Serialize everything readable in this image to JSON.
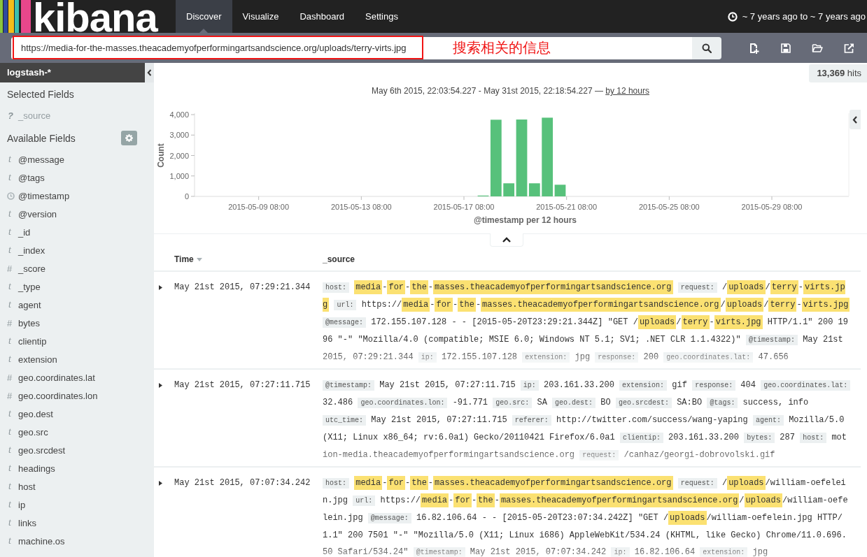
{
  "nav": {
    "logo": "kibana",
    "tabs": [
      {
        "label": "Discover",
        "selected": true
      },
      {
        "label": "Visualize",
        "selected": false
      },
      {
        "label": "Dashboard",
        "selected": false
      },
      {
        "label": "Settings",
        "selected": false
      }
    ],
    "time_range": "~ 7 years ago to ~ 7 years ago"
  },
  "query": {
    "value": "https://media-for-the-masses.theacademyofperformingartsandscience.org/uploads/terry-virts.jpg",
    "annotation": "搜索相关的信息"
  },
  "sidebar": {
    "index_pattern": "logstash-*",
    "selected_title": "Selected Fields",
    "selected_fields": [
      {
        "name": "_source",
        "kind": "unknown",
        "icon": "?"
      }
    ],
    "available_title": "Available Fields",
    "available_fields": [
      {
        "name": "@message",
        "kind": "string",
        "icon": "t"
      },
      {
        "name": "@tags",
        "kind": "string",
        "icon": "t"
      },
      {
        "name": "@timestamp",
        "kind": "date"
      },
      {
        "name": "@version",
        "kind": "string",
        "icon": "t"
      },
      {
        "name": "_id",
        "kind": "string",
        "icon": "t"
      },
      {
        "name": "_index",
        "kind": "string",
        "icon": "t"
      },
      {
        "name": "_score",
        "kind": "number",
        "icon": "#"
      },
      {
        "name": "_type",
        "kind": "string",
        "icon": "t"
      },
      {
        "name": "agent",
        "kind": "string",
        "icon": "t"
      },
      {
        "name": "bytes",
        "kind": "number",
        "icon": "#"
      },
      {
        "name": "clientip",
        "kind": "string",
        "icon": "t"
      },
      {
        "name": "extension",
        "kind": "string",
        "icon": "t"
      },
      {
        "name": "geo.coordinates.lat",
        "kind": "number",
        "icon": "#"
      },
      {
        "name": "geo.coordinates.lon",
        "kind": "number",
        "icon": "#"
      },
      {
        "name": "geo.dest",
        "kind": "string",
        "icon": "t"
      },
      {
        "name": "geo.src",
        "kind": "string",
        "icon": "t"
      },
      {
        "name": "geo.srcdest",
        "kind": "string",
        "icon": "t"
      },
      {
        "name": "headings",
        "kind": "string",
        "icon": "t"
      },
      {
        "name": "host",
        "kind": "string",
        "icon": "t"
      },
      {
        "name": "ip",
        "kind": "string",
        "icon": "t"
      },
      {
        "name": "links",
        "kind": "string",
        "icon": "t"
      },
      {
        "name": "machine.os",
        "kind": "string",
        "icon": "t"
      }
    ]
  },
  "hits": "**13,369** hits",
  "time_header": {
    "range": "May 6th 2015, 22:03:54.227 - May 31st 2015, 22:18:54.227 — ",
    "interval_link": "by 12 hours"
  },
  "histogram": {
    "chart_data": {
      "type": "bar",
      "xlabel": "@timestamp per 12 hours",
      "ylabel": "Count",
      "categories": [
        null,
        null,
        null,
        null,
        null,
        "2015-05-09 08:00",
        null,
        null,
        null,
        null,
        null,
        null,
        null,
        "2015-05-13 08:00",
        null,
        null,
        null,
        null,
        null,
        null,
        null,
        "2015-05-17 08:00",
        null,
        null,
        null,
        null,
        null,
        null,
        null,
        "2015-05-21 08:00",
        null,
        null,
        null,
        null,
        null,
        null,
        null,
        "2015-05-25 08:00",
        null,
        null,
        null,
        null,
        null,
        null,
        null,
        "2015-05-29 08:00",
        null,
        null,
        null,
        null,
        null
      ],
      "series": [
        {
          "color": "#57c17b",
          "values": [
            null,
            null,
            null,
            null,
            null,
            null,
            null,
            null,
            null,
            null,
            null,
            null,
            null,
            null,
            null,
            null,
            null,
            null,
            null,
            null,
            null,
            null,
            40,
            3750,
            640,
            3760,
            640,
            3850,
            570,
            null,
            null,
            null,
            null,
            null,
            null,
            null,
            null,
            null,
            null,
            null,
            null,
            null,
            null,
            null,
            null,
            null,
            null,
            null,
            null,
            null,
            null
          ]
        }
      ],
      "ylim": [
        0,
        4000
      ],
      "yticks": [
        {
          "value": 0,
          "label": "0"
        },
        {
          "value": 1000,
          "label": "1,000"
        },
        {
          "value": 2000,
          "label": "2,000"
        },
        {
          "value": 3000,
          "label": "3,000"
        },
        {
          "value": 4000,
          "label": "4,000"
        }
      ]
    }
  },
  "table": {
    "columns": [
      {
        "label": "Time",
        "sorted": true
      },
      {
        "label": "_source",
        "sorted": false
      }
    ],
    "rows": [
      {
        "expanded": false,
        "time": "May 21st 2015, 07:29:21.344",
        "source": [
          {
            "kind": "key",
            "text": "host:"
          },
          {
            "kind": "match",
            "text": "media"
          },
          {
            "kind": "text",
            "text": "-"
          },
          {
            "kind": "match",
            "text": "for"
          },
          {
            "kind": "text",
            "text": "-"
          },
          {
            "kind": "match",
            "text": "the"
          },
          {
            "kind": "text",
            "text": "-"
          },
          {
            "kind": "match",
            "text": "masses.theacademyofperformingartsandscience.org"
          },
          {
            "kind": "key",
            "text": "request:"
          },
          {
            "kind": "text",
            "text": "/"
          },
          {
            "kind": "match",
            "text": "uploads"
          },
          {
            "kind": "text",
            "text": "/"
          },
          {
            "kind": "match",
            "text": "terry"
          },
          {
            "kind": "text",
            "text": "-"
          },
          {
            "kind": "match",
            "text": "virts.jpg"
          },
          {
            "kind": "key",
            "text": "url:"
          },
          {
            "kind": "text",
            "text": "https://"
          },
          {
            "kind": "match",
            "text": "media"
          },
          {
            "kind": "text",
            "text": "-"
          },
          {
            "kind": "match",
            "text": "for"
          },
          {
            "kind": "text",
            "text": "-"
          },
          {
            "kind": "match",
            "text": "the"
          },
          {
            "kind": "text",
            "text": "-"
          },
          {
            "kind": "match",
            "text": "masses.theacademyofperformingartsandscience.org"
          },
          {
            "kind": "text",
            "text": "/"
          },
          {
            "kind": "match",
            "text": "uploads"
          },
          {
            "kind": "text",
            "text": "/"
          },
          {
            "kind": "match",
            "text": "terry"
          },
          {
            "kind": "text",
            "text": "-"
          },
          {
            "kind": "match",
            "text": "virts.jpg"
          },
          {
            "kind": "key",
            "text": "@message:"
          },
          {
            "kind": "text",
            "text": "172.155.107.128 - - [2015-05-20T23:29:21.344Z] \"GET /"
          },
          {
            "kind": "match",
            "text": "uploads"
          },
          {
            "kind": "text",
            "text": "/"
          },
          {
            "kind": "match",
            "text": "terry"
          },
          {
            "kind": "text",
            "text": "-"
          },
          {
            "kind": "match",
            "text": "virts.jpg"
          },
          {
            "kind": "text",
            "text": " HTTP/1.1\" 200 1996 \"-\" \"Mozilla/4.0 (compatible; MSIE 6.0; Windows NT 5.1; SV1; .NET CLR 1.1.4322)\""
          },
          {
            "kind": "key",
            "text": "@timestamp:"
          },
          {
            "kind": "text",
            "text": "May 21st 2015, 07:29:21.344"
          },
          {
            "kind": "key",
            "text": "ip:"
          },
          {
            "kind": "text",
            "text": "172.155.107.128"
          },
          {
            "kind": "key",
            "text": "extension:"
          },
          {
            "kind": "text",
            "text": "jpg"
          },
          {
            "kind": "key",
            "text": "response:"
          },
          {
            "kind": "text",
            "text": "200"
          },
          {
            "kind": "key",
            "text": "geo.coordinates.lat:"
          },
          {
            "kind": "text",
            "text": "47.656"
          }
        ]
      },
      {
        "expanded": false,
        "time": "May 21st 2015, 07:27:11.715",
        "source": [
          {
            "kind": "key",
            "text": "@timestamp:"
          },
          {
            "kind": "text",
            "text": "May 21st 2015, 07:27:11.715"
          },
          {
            "kind": "key",
            "text": "ip:"
          },
          {
            "kind": "text",
            "text": "203.161.33.200"
          },
          {
            "kind": "key",
            "text": "extension:"
          },
          {
            "kind": "text",
            "text": "gif"
          },
          {
            "kind": "key",
            "text": "response:"
          },
          {
            "kind": "text",
            "text": "404"
          },
          {
            "kind": "key",
            "text": "geo.coordinates.lat:"
          },
          {
            "kind": "text",
            "text": "32.486"
          },
          {
            "kind": "key",
            "text": "geo.coordinates.lon:"
          },
          {
            "kind": "text",
            "text": "-91.771"
          },
          {
            "kind": "key",
            "text": "geo.src:"
          },
          {
            "kind": "text",
            "text": "SA"
          },
          {
            "kind": "key",
            "text": "geo.dest:"
          },
          {
            "kind": "text",
            "text": "BO"
          },
          {
            "kind": "key",
            "text": "geo.srcdest:"
          },
          {
            "kind": "text",
            "text": "SA:BO"
          },
          {
            "kind": "key",
            "text": "@tags:"
          },
          {
            "kind": "text",
            "text": "success, info"
          },
          {
            "kind": "key",
            "text": "utc_time:"
          },
          {
            "kind": "text",
            "text": "May 21st 2015, 07:27:11.715"
          },
          {
            "kind": "key",
            "text": "referer:"
          },
          {
            "kind": "text",
            "text": "http://twitter.com/success/wang-yaping"
          },
          {
            "kind": "key",
            "text": "agent:"
          },
          {
            "kind": "text",
            "text": "Mozilla/5.0 (X11; Linux x86_64; rv:6.0a1) Gecko/20110421 Firefox/6.0a1"
          },
          {
            "kind": "key",
            "text": "clientip:"
          },
          {
            "kind": "text",
            "text": "203.161.33.200"
          },
          {
            "kind": "key",
            "text": "bytes:"
          },
          {
            "kind": "text",
            "text": "287"
          },
          {
            "kind": "key",
            "text": "host:"
          },
          {
            "kind": "text",
            "text": "motion-media.theacademyofperformingartsandscience.org"
          },
          {
            "kind": "key",
            "text": "request:"
          },
          {
            "kind": "text",
            "text": "/canhaz/georgi-dobrovolski.gif"
          }
        ]
      },
      {
        "expanded": false,
        "time": "May 21st 2015, 07:07:34.242",
        "source": [
          {
            "kind": "key",
            "text": "host:"
          },
          {
            "kind": "match",
            "text": "media"
          },
          {
            "kind": "text",
            "text": "-"
          },
          {
            "kind": "match",
            "text": "for"
          },
          {
            "kind": "text",
            "text": "-"
          },
          {
            "kind": "match",
            "text": "the"
          },
          {
            "kind": "text",
            "text": "-"
          },
          {
            "kind": "match",
            "text": "masses.theacademyofperformingartsandscience.org"
          },
          {
            "kind": "key",
            "text": "request:"
          },
          {
            "kind": "text",
            "text": "/"
          },
          {
            "kind": "match",
            "text": "uploads"
          },
          {
            "kind": "text",
            "text": "/william-oefelein.jpg"
          },
          {
            "kind": "key",
            "text": "url:"
          },
          {
            "kind": "text",
            "text": "https://"
          },
          {
            "kind": "match",
            "text": "media"
          },
          {
            "kind": "text",
            "text": "-"
          },
          {
            "kind": "match",
            "text": "for"
          },
          {
            "kind": "text",
            "text": "-"
          },
          {
            "kind": "match",
            "text": "the"
          },
          {
            "kind": "text",
            "text": "-"
          },
          {
            "kind": "match",
            "text": "masses.theacademyofperformingartsandscience.org"
          },
          {
            "kind": "text",
            "text": "/"
          },
          {
            "kind": "match",
            "text": "uploads"
          },
          {
            "kind": "text",
            "text": "/william-oefelein.jpg"
          },
          {
            "kind": "key",
            "text": "@message:"
          },
          {
            "kind": "text",
            "text": "16.82.106.64 - - [2015-05-20T23:07:34.242Z] \"GET /"
          },
          {
            "kind": "match",
            "text": "uploads"
          },
          {
            "kind": "text",
            "text": "/william-oefelein.jpg HTTP/1.1\" 200 7501 \"-\" \"Mozilla/5.0 (X11; Linux i686) AppleWebKit/534.24 (KHTML, like Gecko) Chrome/11.0.696.50 Safari/534.24\""
          },
          {
            "kind": "key",
            "text": "@timestamp:"
          },
          {
            "kind": "text",
            "text": "May 21st 2015, 07:07:34.242"
          },
          {
            "kind": "key",
            "text": "ip:"
          },
          {
            "kind": "text",
            "text": "16.82.106.64"
          },
          {
            "kind": "key",
            "text": "extension:"
          },
          {
            "kind": "text",
            "text": "jpg"
          }
        ]
      }
    ]
  }
}
